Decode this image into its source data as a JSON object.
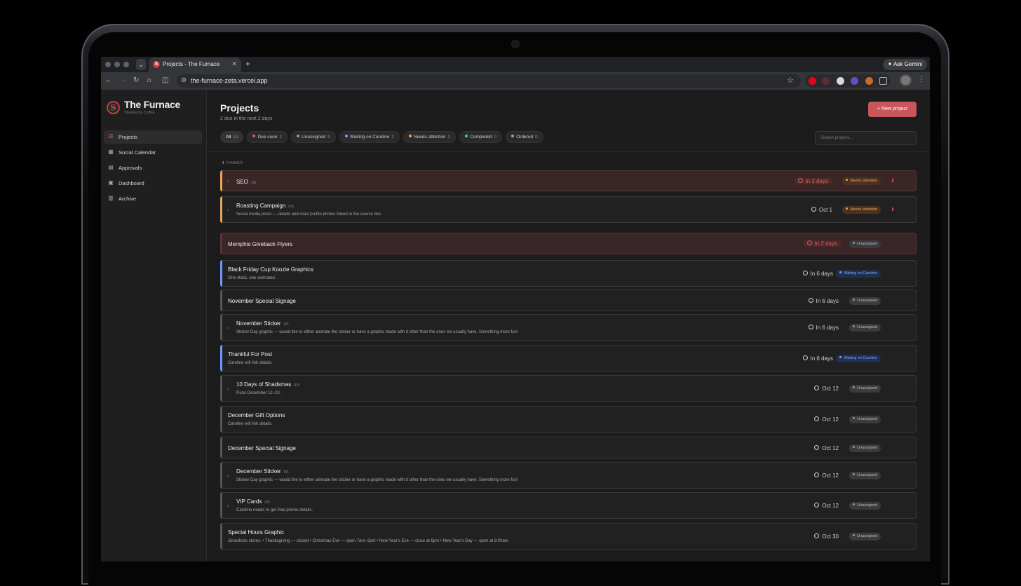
{
  "browser": {
    "tab_title": "Projects - The Furnace",
    "tab_favicon": "S",
    "url": "the-furnace-zeta.vercel.app",
    "ask_gemini": "Ask Gemini"
  },
  "sidebar": {
    "brand": "The Furnace",
    "brand_sub": "Shadrachs Coffee",
    "logo_letter": "S",
    "items": [
      {
        "label": "Projects",
        "icon": "list-icon",
        "active": true
      },
      {
        "label": "Social Calendar",
        "icon": "calendar-icon"
      },
      {
        "label": "Approvals",
        "icon": "document-icon"
      },
      {
        "label": "Dashboard",
        "icon": "grid-icon"
      },
      {
        "label": "Archive",
        "icon": "archive-icon"
      }
    ]
  },
  "main": {
    "title": "Projects",
    "subtitle": "2 due in the next 2 days",
    "new_project": "New project",
    "search_placeholder": "Search projects...",
    "pinned_label": "PINNED",
    "filters": [
      {
        "label": "All",
        "count": "13",
        "dot": ""
      },
      {
        "label": "Due soon",
        "count": "2",
        "dot": "#e15d5d"
      },
      {
        "label": "Unassigned",
        "count": "9",
        "dot": "#9a9a9a"
      },
      {
        "label": "Waiting on Caroline",
        "count": "2",
        "dot": "#6b9cff"
      },
      {
        "label": "Needs attention",
        "count": "2",
        "dot": "#f0a458"
      },
      {
        "label": "Completed",
        "count": "0",
        "dot": "#4cd47a"
      },
      {
        "label": "Ordered",
        "count": "0",
        "dot": "#a0a0a0"
      }
    ],
    "projects": [
      {
        "title": "SEO",
        "count": "1/6",
        "desc": "",
        "due": "In 2 days",
        "status": "Needs attention"
      },
      {
        "title": "Roasting Campaign",
        "count": "0/5",
        "desc": "Social media posts — details and roast profile photos linked in the source doc.",
        "due": "Oct 1",
        "status": "Needs attention"
      },
      {
        "title": "Memphis Giveback Flyers",
        "count": "",
        "desc": "",
        "due": "In 2 days",
        "status": "Unassigned"
      },
      {
        "title": "Black Friday Cup Koozie Graphics",
        "count": "",
        "desc": "One static, one animated.",
        "due": "In 6 days",
        "status": "Waiting on Caroline"
      },
      {
        "title": "November Special Signage",
        "count": "",
        "desc": "",
        "due": "In 6 days",
        "status": "Unassigned"
      },
      {
        "title": "November Sticker",
        "count": "0/1",
        "desc": "Sticker Day graphic — would like to either animate the sticker or have a graphic made with it other than the ones we usually have. Something more fun!",
        "due": "In 6 days",
        "status": "Unassigned"
      },
      {
        "title": "Thankful For Post",
        "count": "",
        "desc": "Caroline will link details.",
        "due": "In 6 days",
        "status": "Waiting on Caroline"
      },
      {
        "title": "10 Days of Shadsmas",
        "count": "0/3",
        "desc": "Runs December 12–23.",
        "due": "Oct 12",
        "status": "Unassigned"
      },
      {
        "title": "December Gift Options",
        "count": "",
        "desc": "Caroline will link details.",
        "due": "Oct 12",
        "status": "Unassigned"
      },
      {
        "title": "December Special Signage",
        "count": "",
        "desc": "",
        "due": "Oct 12",
        "status": "Unassigned"
      },
      {
        "title": "December Sticker",
        "count": "0/1",
        "desc": "Sticker Day graphic — would like to either animate the sticker or have a graphic made with it other than the ones we usually have. Something more fun!",
        "due": "Oct 12",
        "status": "Unassigned"
      },
      {
        "title": "VIP Cards",
        "count": "0/3",
        "desc": "Caroline needs to get final promo details.",
        "due": "Oct 12",
        "status": "Unassigned"
      },
      {
        "title": "Special Hours Graphic",
        "count": "",
        "desc": "Jonesboro stores: • Thanksgiving — closed • Christmas Eve — open 7am–2pm • New Year's Eve — close at 6pm • New Year's Day — open at 8:00am",
        "due": "Oct 30",
        "status": "Unassigned"
      }
    ]
  },
  "colors": {
    "accent": "#c9575a",
    "urgent": "#e15d5d",
    "needs_attention": "#f0a458",
    "waiting": "#6b9cff",
    "unassigned": "#9a9a9a"
  }
}
